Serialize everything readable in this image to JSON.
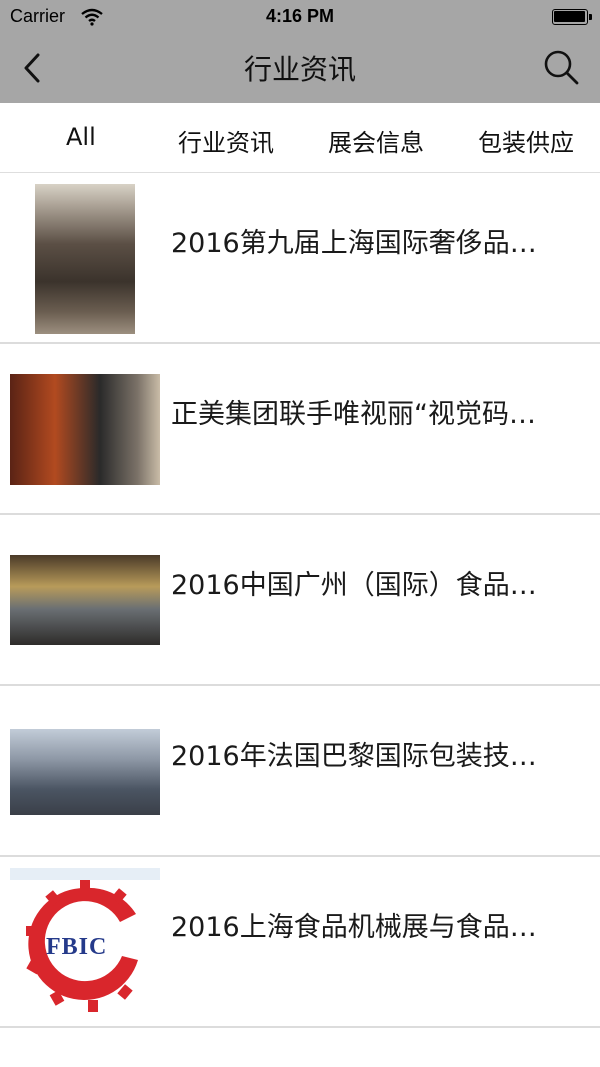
{
  "status_bar": {
    "carrier": "Carrier",
    "time": "4:16 PM"
  },
  "nav": {
    "title": "行业资讯",
    "back_icon": "chevron-left-icon",
    "search_icon": "search-icon"
  },
  "tabs": [
    {
      "label": "All"
    },
    {
      "label": "行业资讯"
    },
    {
      "label": "展会信息"
    },
    {
      "label": "包装供应"
    }
  ],
  "news": [
    {
      "title": "2016第九届上海国际奢侈品…",
      "thumb": "crowded-expo-hall-photo"
    },
    {
      "title": "正美集团联手唯视丽“视觉码…",
      "thumb": "exhibition-booth-photo"
    },
    {
      "title": "2016中国广州（国际）食品…",
      "thumb": "food-expo-booth-photo"
    },
    {
      "title": "2016年法国巴黎国际包装技…",
      "thumb": "packaging-expo-hall-photo"
    },
    {
      "title": "2016上海食品机械展与食品…",
      "thumb": "fbic-logo",
      "logo_text": "FBIC"
    }
  ],
  "colors": {
    "header_bg": "#a6a6a6",
    "divider": "#dcdcdc",
    "logo_red": "#d9262c",
    "logo_blue": "#253a8a"
  }
}
